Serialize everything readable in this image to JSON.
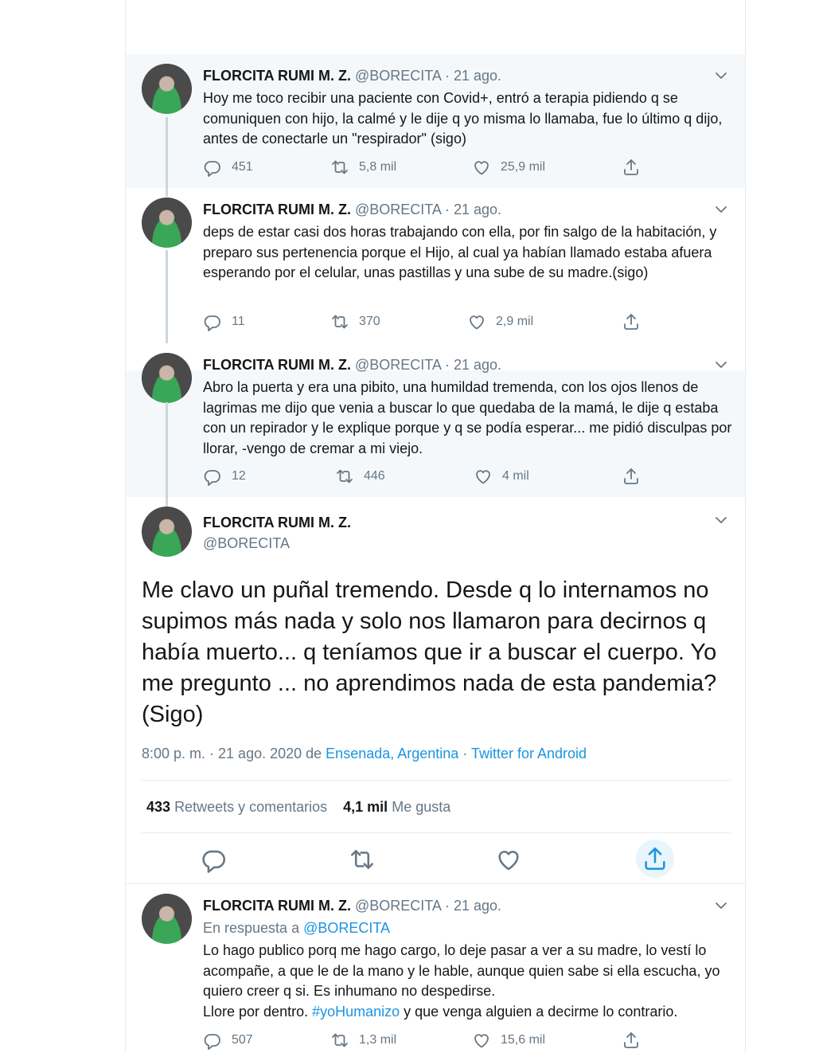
{
  "author": {
    "name": "FLORCITA RUMI M. Z.",
    "handle": "@BORECITA",
    "separator": "·"
  },
  "tweets": [
    {
      "date": "21 ago.",
      "text": "Hoy me toco recibir una paciente con Covid+, entró a terapia pidiendo q se comuniquen con hijo, la calmé y le dije q yo misma lo llamaba, fue lo último q dijo, antes de conectarle un \"respirador\" (sigo)",
      "replies": "451",
      "retweets": "5,8 mil",
      "likes": "25,9 mil"
    },
    {
      "date": "21 ago.",
      "text": "deps de estar casi dos horas trabajando con ella, por fin salgo de la habitación, y preparo sus pertenencia porque el Hijo, al cual ya habían llamado estaba afuera esperando por el celular, unas pastillas y una sube de su madre.(sigo)",
      "replies": "11",
      "retweets": "370",
      "likes": "2,9 mil"
    },
    {
      "date": "21 ago.",
      "text": "Abro la puerta y era una pibito, una humildad tremenda, con los ojos llenos de lagrimas me dijo que venia a buscar lo que quedaba de la mamá, le dije q estaba con un repirador y le explique porque y q se podía esperar... me pidió disculpas por llorar, -vengo de cremar a mi viejo.",
      "replies": "12",
      "retweets": "446",
      "likes": "4 mil"
    }
  ],
  "main_tweet": {
    "text": "Me clavo un puñal tremendo. Desde q lo internamos no supimos más nada y solo nos llamaron para decirnos q había muerto... q teníamos que ir a buscar el cuerpo. Yo me pregunto ... no aprendimos nada de esta pandemia? (Sigo)",
    "time": "8:00 p. m. · 21 ago. 2020 de ",
    "location": "Ensenada, Argentina",
    "source_sep": " · ",
    "source": "Twitter for Android",
    "retweets_count": "433",
    "retweets_label": "Retweets y comentarios",
    "likes_count": "4,1 mil",
    "likes_label": "Me gusta"
  },
  "reply_tweet": {
    "date": "21 ago.",
    "in_reply_prefix": "En respuesta a ",
    "in_reply_handle": "@BORECITA",
    "text_part1": "Lo hago publico porq me hago cargo, lo deje pasar a ver a su madre, lo vestí lo acompañe, a que le de la mano y le hable, aunque quien sabe si ella escucha, yo quiero creer q si. Es inhumano no despedirse.",
    "text_part2": "Llore por dentro. ",
    "hashtag": "#yoHumanizo",
    "text_part3": " y que venga alguien a decirme lo contrario.",
    "replies": "507",
    "retweets": "1,3 mil",
    "likes": "15,6 mil"
  },
  "icons": {
    "reply": "reply-icon",
    "retweet": "retweet-icon",
    "like": "heart-icon",
    "share": "share-icon",
    "caret": "chevron-down-icon"
  },
  "colors": {
    "link": "#1b95e0",
    "muted": "#657786",
    "shaded_bg": "#f5f8fa"
  }
}
